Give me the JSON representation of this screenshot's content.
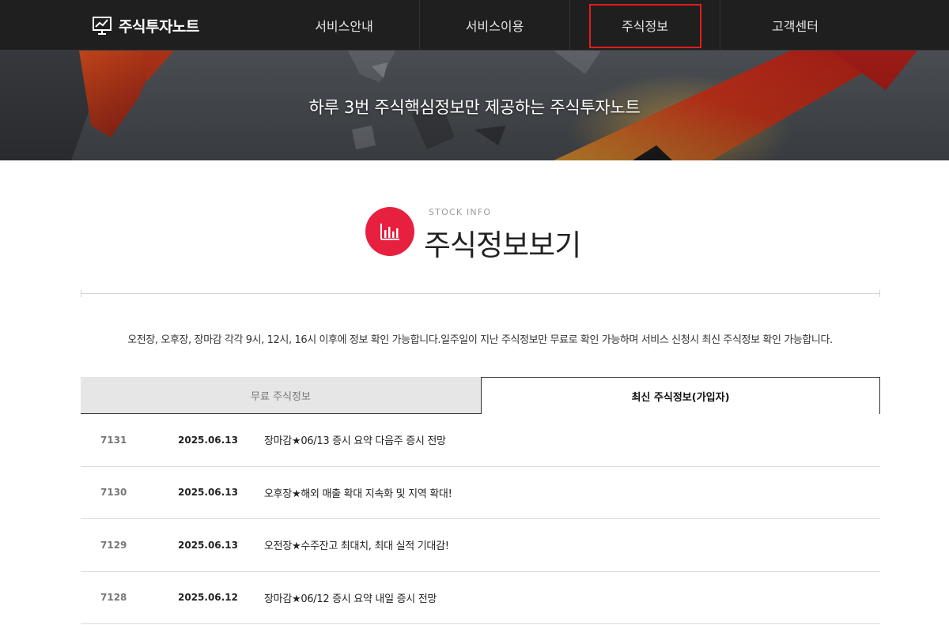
{
  "header": {
    "logo_text": "주식투자노트",
    "nav": [
      {
        "label": "서비스안내"
      },
      {
        "label": "서비스이용"
      },
      {
        "label": "주식정보"
      },
      {
        "label": "고객센터"
      }
    ],
    "active_index": 2
  },
  "hero": {
    "title": "하루 3번 주식핵심정보만 제공하는 주식투자노트"
  },
  "section": {
    "eyebrow": "STOCK INFO",
    "title": "주식정보보기",
    "icon": "bar-chart-icon",
    "accent_color": "#e8203f"
  },
  "notice": "오전장, 오후장, 장마감 각각 9시, 12시, 16시 이후에 정보 확인 가능합니다.일주일이 지난 주식정보만 무료로 확인 가능하며 서비스 신청시 최신 주식정보 확인 가능합니다.",
  "tabs": {
    "free_label": "무료 주식정보",
    "latest_label": "최신 주식정보(가입자)",
    "selected": "latest"
  },
  "posts": [
    {
      "num": "7131",
      "date": "2025.06.13",
      "subject": "장마감★06/13 증시 요약 다음주 증시 전망"
    },
    {
      "num": "7130",
      "date": "2025.06.13",
      "subject": "오후장★해외 매출 확대 지속화 및 지역 확대!"
    },
    {
      "num": "7129",
      "date": "2025.06.13",
      "subject": "오전장★수주잔고 최대치, 최대 실적 기대감!"
    },
    {
      "num": "7128",
      "date": "2025.06.12",
      "subject": "장마감★06/12 증시 요약 내일 증시 전망"
    }
  ]
}
